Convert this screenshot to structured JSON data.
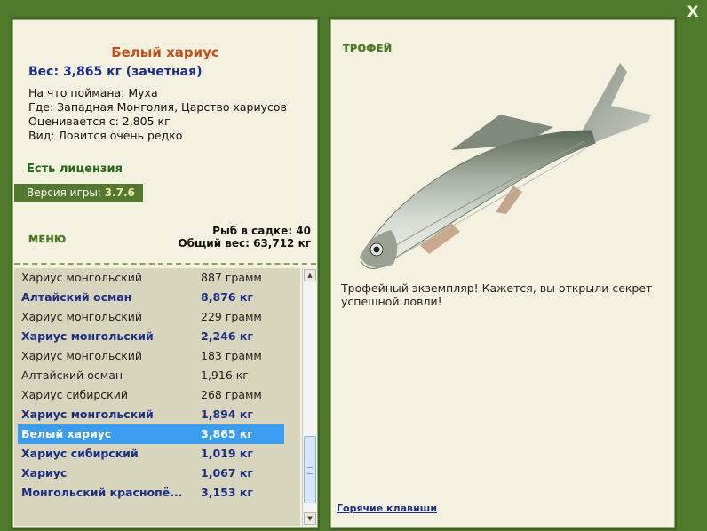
{
  "close_label": "X",
  "fish": {
    "title": "Белый хариус",
    "weight": "Вес: 3,865 кг (зачетная)",
    "caught_on": "На что поймана: Муха",
    "location": "Где: Западная Монголия, Царство хариусов",
    "value": "Оценивается с: 2,805 кг",
    "rarity": "Вид: Ловится очень редко"
  },
  "license": "Есть лицензия",
  "version": {
    "label": "Версия игры:",
    "number": "3.7.6"
  },
  "menu_label": "МЕНЮ",
  "keepnet": {
    "count": "Рыб в садке: 40",
    "total_weight": "Общий вес: 63,712 кг"
  },
  "catch_list": [
    {
      "name": "Хариус монгольский",
      "weight": "887 грамм",
      "style": "normal"
    },
    {
      "name": "Алтайский осман",
      "weight": "8,876 кг",
      "style": "bold"
    },
    {
      "name": "Хариус монгольский",
      "weight": "229 грамм",
      "style": "normal"
    },
    {
      "name": "Хариус монгольский",
      "weight": "2,246 кг",
      "style": "bold"
    },
    {
      "name": "Хариус монгольский",
      "weight": "183 грамм",
      "style": "normal"
    },
    {
      "name": "Алтайский осман",
      "weight": "1,916 кг",
      "style": "normal"
    },
    {
      "name": "Хариус сибирский",
      "weight": "268 грамм",
      "style": "normal"
    },
    {
      "name": "Хариус монгольский",
      "weight": "1,894 кг",
      "style": "bold"
    },
    {
      "name": "Белый хариус",
      "weight": "3,865 кг",
      "style": "selected"
    },
    {
      "name": "Хариус сибирский",
      "weight": "1,019 кг",
      "style": "bold"
    },
    {
      "name": "Хариус",
      "weight": "1,067 кг",
      "style": "bold"
    },
    {
      "name": "Монгольский краснопё...",
      "weight": "3,153 кг",
      "style": "bold"
    }
  ],
  "scrollbar": {
    "up": "▲",
    "down": "▼"
  },
  "trophy": {
    "label": "ТРОФЕЙ",
    "text": "Трофейный экземпляр! Кажется, вы открыли секрет успешной ловли!"
  },
  "hotkeys": "Горячие клавиши",
  "colors": {
    "background": "#4f7a2c",
    "panel": "#f4f1e0",
    "title": "#c0501a",
    "weight_blue": "#1b2f86",
    "license_green": "#1e6b16",
    "selected_row": "#3b9df0"
  }
}
